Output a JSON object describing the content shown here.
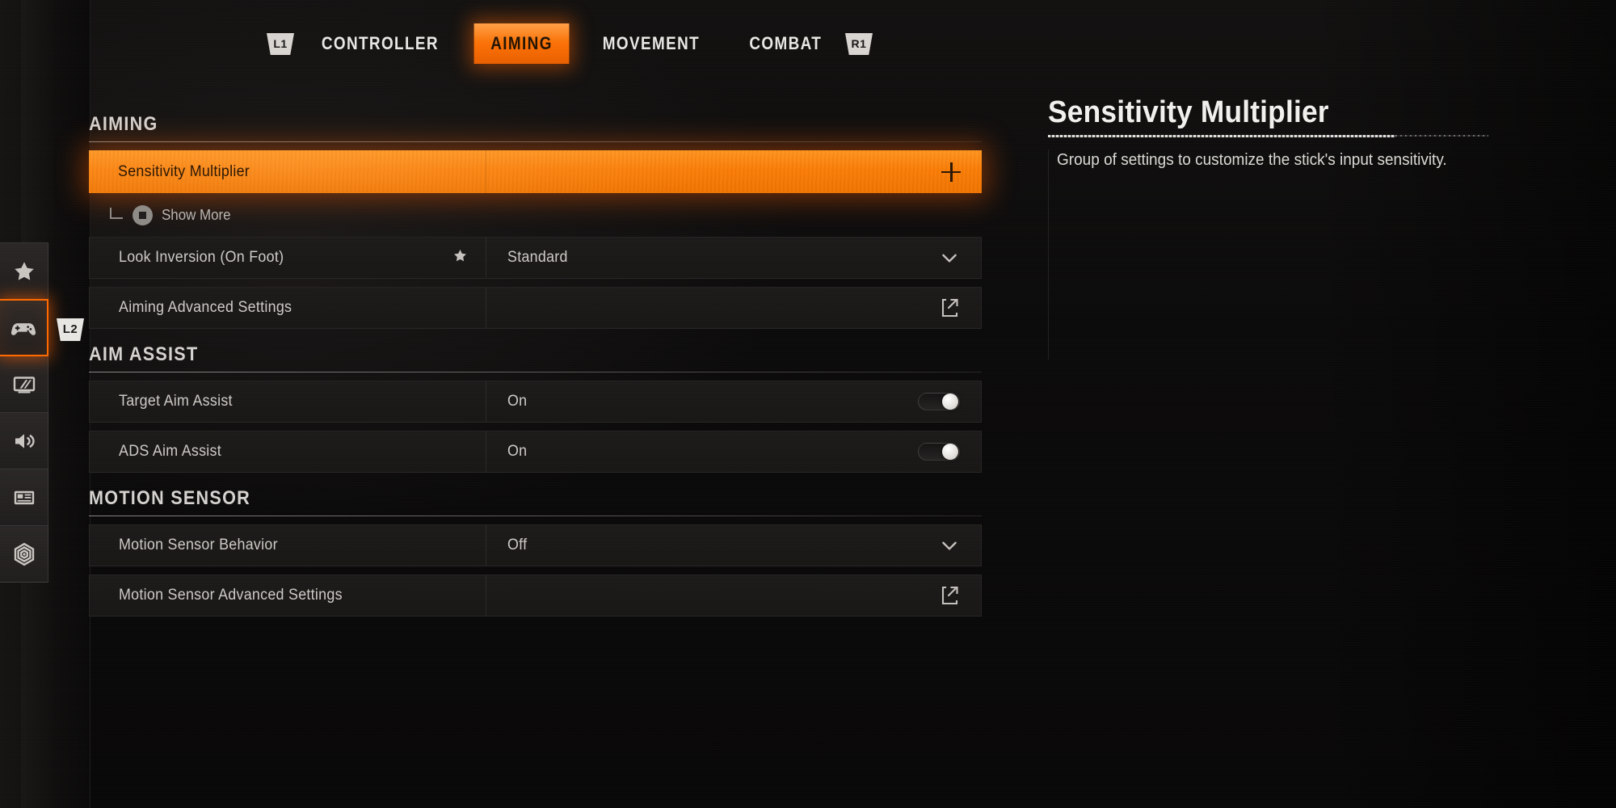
{
  "sidebar": {
    "items": [
      {
        "name": "favorites",
        "icon": "star-icon",
        "active": false
      },
      {
        "name": "controller",
        "icon": "gamepad-icon",
        "active": true,
        "badge": "L2"
      },
      {
        "name": "graphics",
        "icon": "monitor-icon",
        "active": false
      },
      {
        "name": "audio",
        "icon": "speaker-icon",
        "active": false
      },
      {
        "name": "interface",
        "icon": "hud-layout-icon",
        "active": false
      },
      {
        "name": "telemetry",
        "icon": "radar-hex-icon",
        "active": false
      }
    ]
  },
  "tabbar": {
    "left_bumper": "L1",
    "right_bumper": "R1",
    "tabs": [
      {
        "label": "CONTROLLER",
        "active": false
      },
      {
        "label": "AIMING",
        "active": true
      },
      {
        "label": "MOVEMENT",
        "active": false
      },
      {
        "label": "COMBAT",
        "active": false
      }
    ]
  },
  "sections": [
    {
      "title": "AIMING",
      "rows": [
        {
          "label": "Sensitivity Multiplier",
          "value": "",
          "control": "expand",
          "control_glyph": "plus-icon",
          "selected": true,
          "favorite": false
        },
        {
          "label": "Look Inversion (On Foot)",
          "value": "Standard",
          "control": "dropdown",
          "control_glyph": "chevron-down-icon",
          "selected": false,
          "favorite": true
        },
        {
          "label": "Aiming Advanced Settings",
          "value": "",
          "control": "submenu",
          "control_glyph": "external-link-icon",
          "selected": false,
          "favorite": false
        }
      ]
    },
    {
      "title": "AIM ASSIST",
      "rows": [
        {
          "label": "Target Aim Assist",
          "value": "On",
          "control": "toggle",
          "control_glyph": "toggle-switch",
          "toggle_state": "on",
          "selected": false,
          "favorite": false
        },
        {
          "label": "ADS Aim Assist",
          "value": "On",
          "control": "toggle",
          "control_glyph": "toggle-switch",
          "toggle_state": "on",
          "selected": false,
          "favorite": false
        }
      ]
    },
    {
      "title": "MOTION SENSOR",
      "rows": [
        {
          "label": "Motion Sensor Behavior",
          "value": "Off",
          "control": "dropdown",
          "control_glyph": "chevron-down-icon",
          "selected": false,
          "favorite": false
        },
        {
          "label": "Motion Sensor Advanced Settings",
          "value": "",
          "control": "submenu",
          "control_glyph": "external-link-icon",
          "selected": false,
          "favorite": false
        }
      ]
    }
  ],
  "show_more": {
    "label": "Show More",
    "button_glyph": "ps-square-button-icon"
  },
  "info_panel": {
    "title": "Sensitivity Multiplier",
    "description": "Group of settings to customize the stick's input sensitivity."
  },
  "colors": {
    "accent": "#f97c06",
    "accent_bright": "#ff941f",
    "background": "#0b0a0a",
    "row_background": "#1c1a19",
    "text_primary": "#cdcac6",
    "text_bright": "#f2f0ed",
    "text_on_accent": "#2a1704"
  }
}
